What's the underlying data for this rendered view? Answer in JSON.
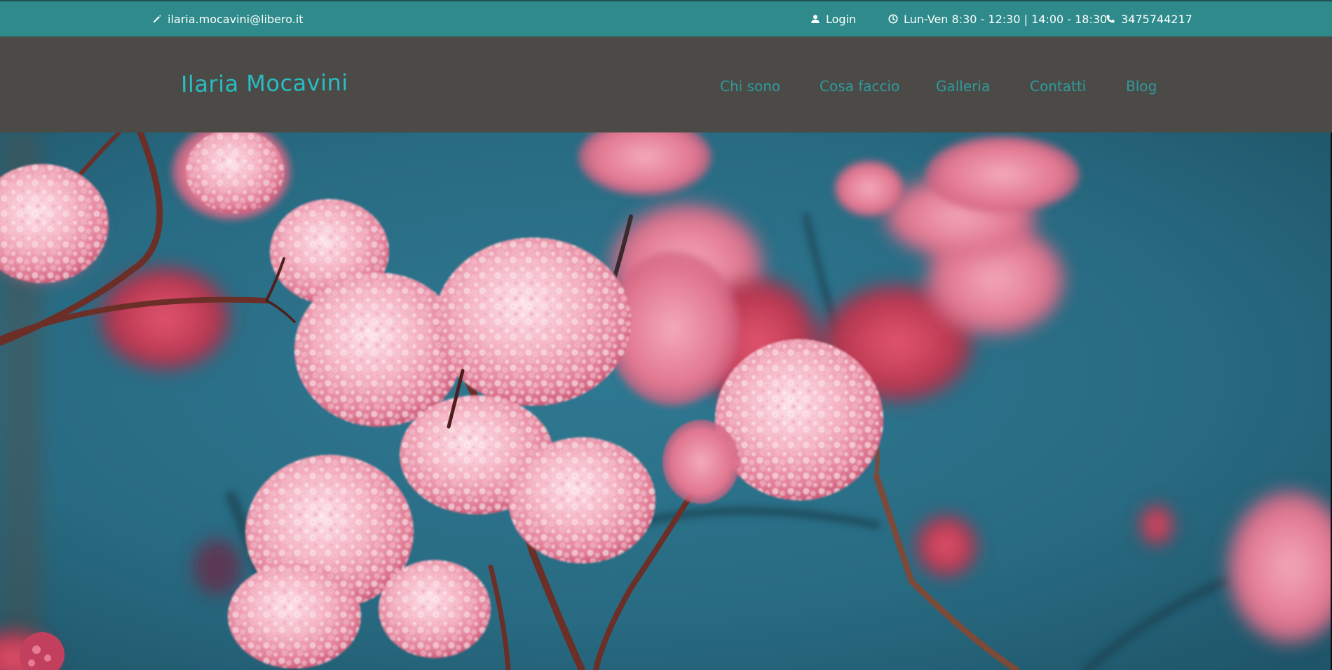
{
  "topbar": {
    "email": "ilaria.mocavini@libero.it",
    "login": "Login",
    "hours": "Lun-Ven 8:30 - 12:30 | 14:00 - 18:30",
    "phone": "3475744217",
    "icons": [
      "pencil-icon",
      "user-icon",
      "clock-icon",
      "phone-icon"
    ]
  },
  "header": {
    "logo": "Ilaria Mocavini",
    "nav": [
      "Chi sono",
      "Cosa faccio",
      "Galleria",
      "Contatti",
      "Blog"
    ]
  },
  "colors": {
    "topbar": "#2f8b8b",
    "header": "#4b4a47",
    "logo": "#29bcc2",
    "nav": "#2f9a9c",
    "hero_background": "#2b6e84",
    "blossom": "#f3a8b8"
  }
}
